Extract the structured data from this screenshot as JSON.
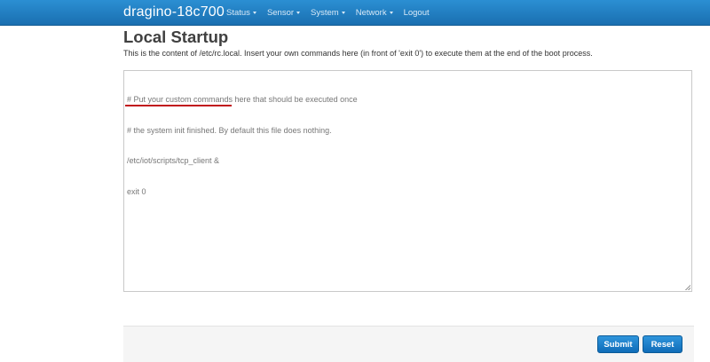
{
  "navbar": {
    "brand": "dragino-18c700",
    "items": [
      {
        "label": "Status",
        "dropdown": true
      },
      {
        "label": "Sensor",
        "dropdown": true
      },
      {
        "label": "System",
        "dropdown": true
      },
      {
        "label": "Network",
        "dropdown": true
      },
      {
        "label": "Logout",
        "dropdown": false
      }
    ]
  },
  "page": {
    "title": "Local Startup",
    "description": "This is the content of /etc/rc.local. Insert your own commands here (in front of 'exit 0') to execute them at the end of the boot process."
  },
  "editor": {
    "lines": [
      "# Put your custom commands here that should be executed once",
      "# the system init finished. By default this file does nothing.",
      "/etc/iot/scripts/tcp_client &",
      "exit 0"
    ],
    "highlight_color": "#c1121c"
  },
  "actions": {
    "submit_label": "Submit",
    "reset_label": "Reset"
  },
  "colors": {
    "navbar": "#1e7ec3",
    "button": "#1a7cc7"
  }
}
